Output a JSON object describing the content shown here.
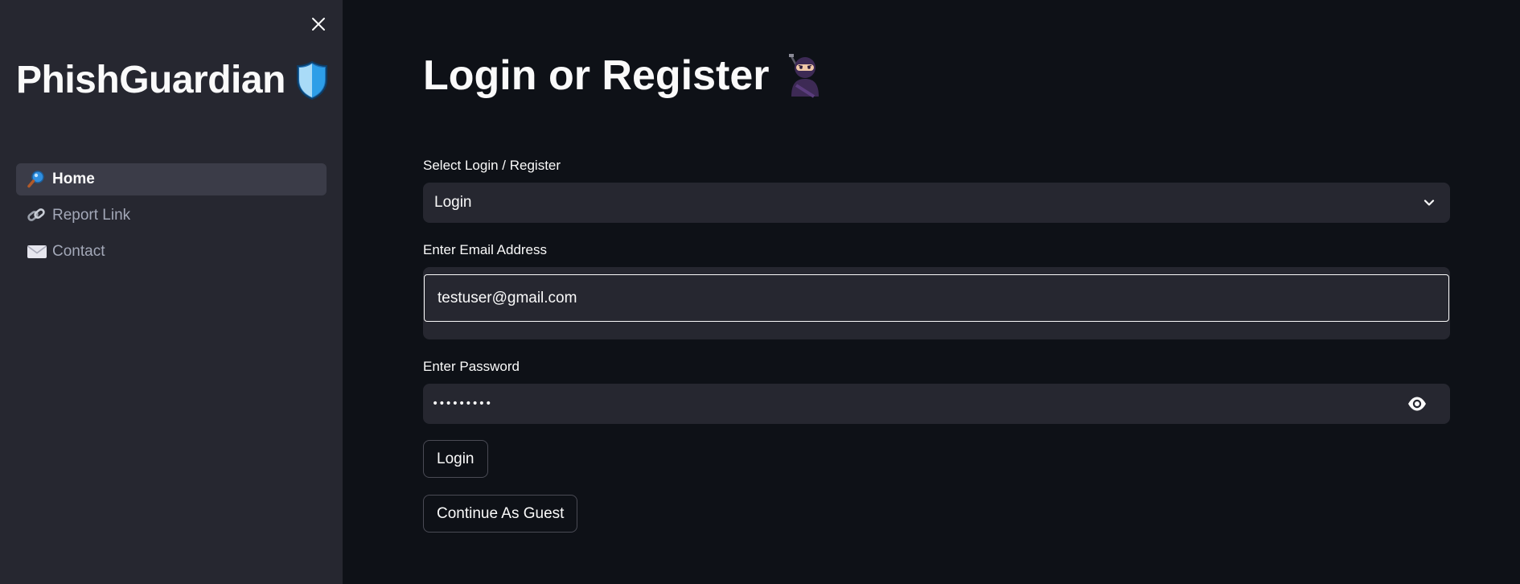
{
  "sidebar": {
    "brand_title": "PhishGuardian",
    "nav": [
      {
        "label": "Home",
        "icon": "magnifier-icon",
        "active": true
      },
      {
        "label": "Report Link",
        "icon": "link-icon",
        "active": false
      },
      {
        "label": "Contact",
        "icon": "envelope-icon",
        "active": false
      }
    ]
  },
  "main": {
    "title": "Login or Register",
    "select": {
      "label": "Select Login / Register",
      "value": "Login"
    },
    "email": {
      "label": "Enter Email Address",
      "value": "testuser@gmail.com"
    },
    "password": {
      "label": "Enter Password",
      "value": "testuser1"
    },
    "login_button": "Login",
    "guest_button": "Continue As Guest"
  },
  "colors": {
    "background": "#0e1117",
    "sidebar": "#262730",
    "input_bg": "#262730",
    "text": "#fafafa",
    "muted_text": "#a3a8b8",
    "active_nav": "#3b3c48"
  }
}
